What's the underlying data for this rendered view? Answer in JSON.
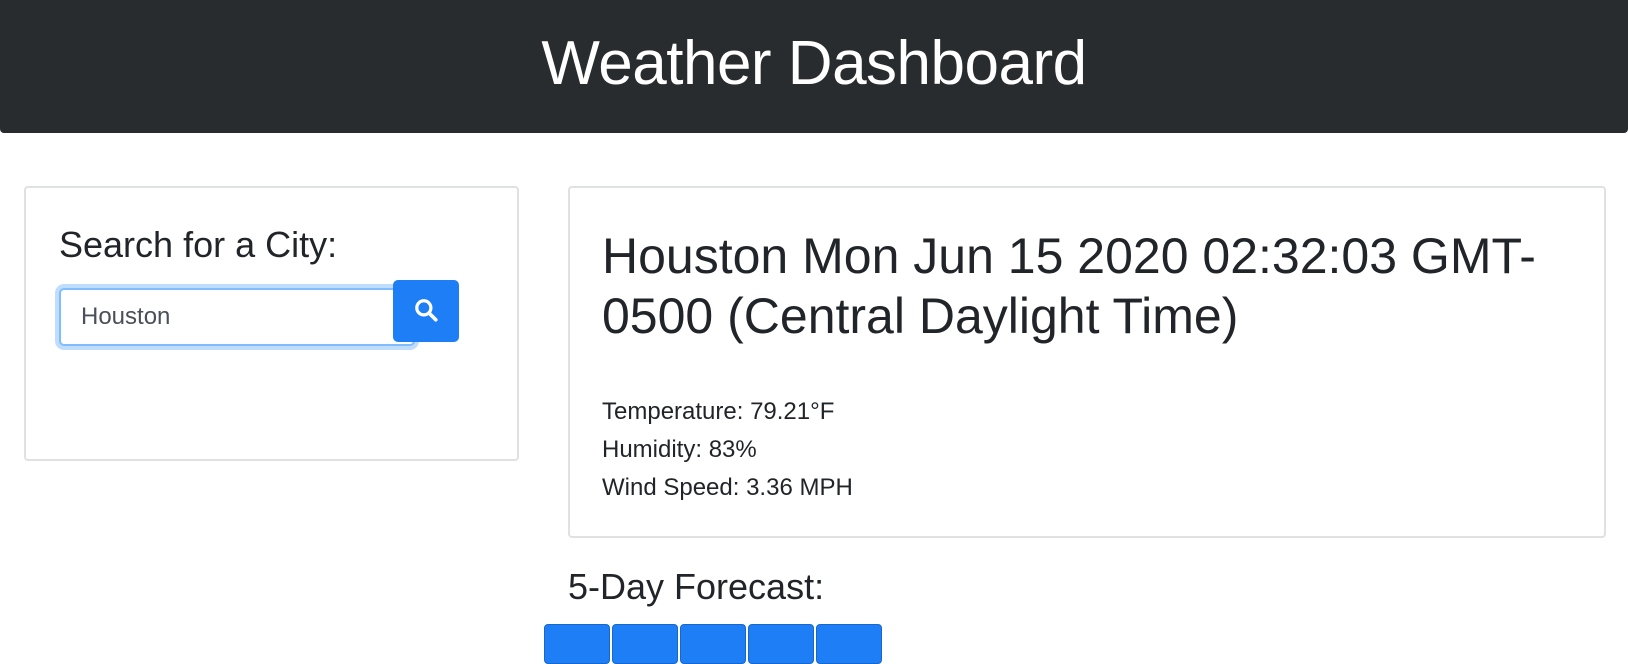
{
  "header": {
    "title": "Weather Dashboard"
  },
  "search": {
    "label": "Search for a City:",
    "value": "Houston",
    "placeholder": "",
    "button_icon": "search-icon"
  },
  "current": {
    "title": "Houston Mon Jun 15 2020 02:32:03 GMT-0500 (Central Daylight Time)",
    "temperature": "Temperature: 79.21°F",
    "humidity": "Humidity: 83%",
    "wind_speed": "Wind Speed: 3.36 MPH"
  },
  "forecast": {
    "heading": "5-Day Forecast:",
    "cards": [
      {
        "label": ""
      },
      {
        "label": ""
      },
      {
        "label": ""
      },
      {
        "label": ""
      },
      {
        "label": ""
      }
    ]
  },
  "colors": {
    "header_bg": "#292c2e",
    "accent": "#1e7ef5",
    "focus_ring": "#80bdff"
  }
}
